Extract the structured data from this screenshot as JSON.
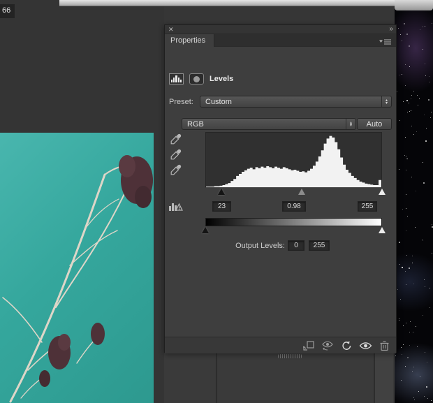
{
  "desktop": {
    "doc_tab_text": "66"
  },
  "panel": {
    "icons": {
      "close": "✕",
      "collapse": "››",
      "stepper_up": "▴",
      "stepper_down": "▾"
    },
    "tab_label": "Properties",
    "header": {
      "title": "Levels"
    },
    "preset_label": "Preset:",
    "preset_value": "Custom",
    "channel_value": "RGB",
    "auto_label": "Auto",
    "input_levels": {
      "black": "23",
      "gamma": "0.98",
      "white": "255"
    },
    "output": {
      "label": "Output Levels:",
      "black": "0",
      "white": "255"
    },
    "histogram_values": [
      1,
      1,
      1,
      2,
      2,
      3,
      4,
      6,
      8,
      12,
      16,
      22,
      26,
      30,
      33,
      36,
      38,
      35,
      39,
      37,
      40,
      38,
      41,
      39,
      37,
      40,
      38,
      36,
      39,
      37,
      35,
      33,
      34,
      32,
      30,
      31,
      29,
      32,
      36,
      42,
      50,
      60,
      72,
      85,
      95,
      100,
      97,
      88,
      74,
      58,
      44,
      34,
      28,
      22,
      18,
      14,
      11,
      9,
      7,
      6,
      5,
      4,
      4,
      14
    ]
  },
  "colors": {
    "panel_bg": "#3e3e3e",
    "photo_teal": "#35a79d",
    "histogram_fill": "#f2f2f2"
  }
}
